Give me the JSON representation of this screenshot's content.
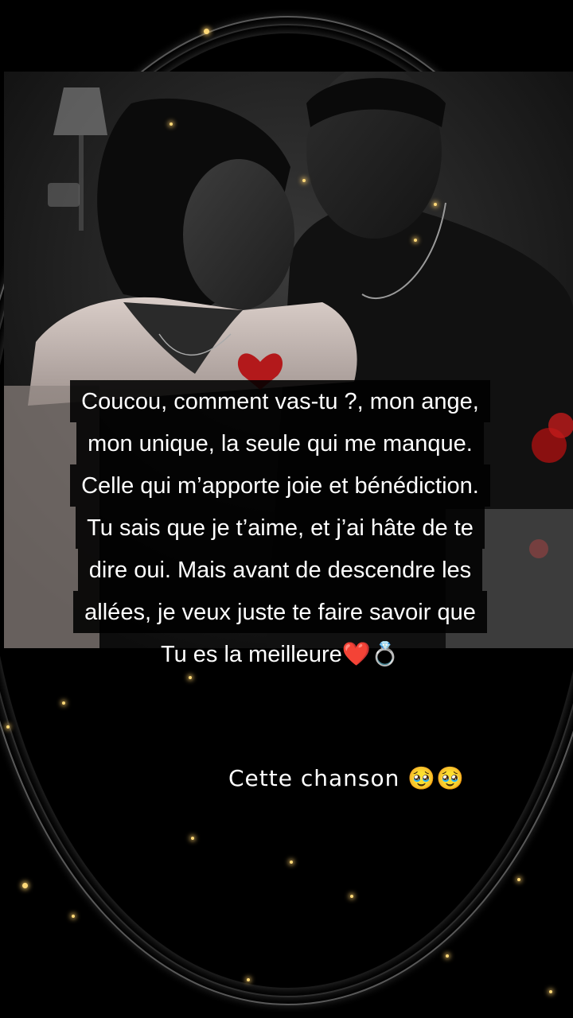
{
  "caption": {
    "lines": [
      "Coucou, comment vas-tu ?, mon ange,",
      "mon unique, la seule qui me manque.",
      "Celle qui m’apporte joie et bénédiction.",
      "Tu sais que je t’aime, et j’ai hâte de te",
      "dire oui. Mais avant de descendre les",
      "allées, je veux juste te faire savoir que"
    ],
    "last_line": "Tu es la meilleure❤️💍"
  },
  "subtitle": {
    "text": "Cette chanson",
    "emoji": "🥹🥹"
  },
  "colors": {
    "background": "#000000",
    "caption_bg": "#000000",
    "text": "#ffffff",
    "sparkle": "#ffd978",
    "heart": "#b3191b"
  }
}
